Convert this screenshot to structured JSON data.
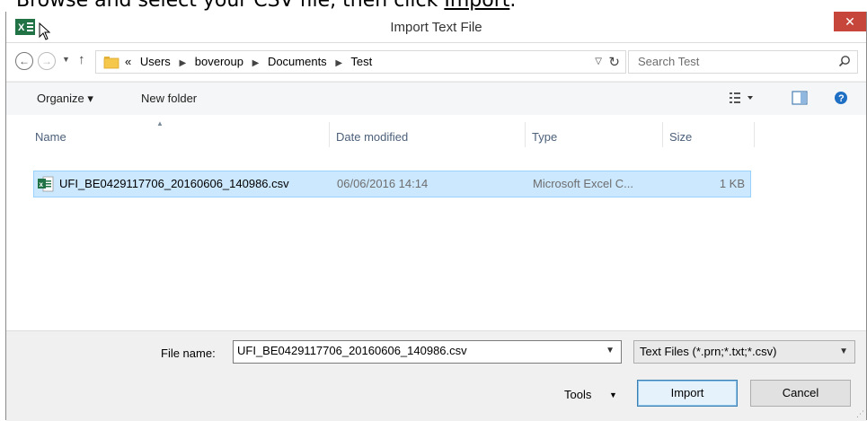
{
  "caption": {
    "prefix": "Browse and select your CSV file, then click ",
    "link": "Import",
    "suffix": "."
  },
  "window": {
    "title": "Import Text File",
    "close_glyph": "✕"
  },
  "nav": {
    "back_glyph": "←",
    "forward_glyph": "→",
    "up_glyph": "↑",
    "breadcrumb": [
      "«",
      "Users",
      "boveroup",
      "Documents",
      "Test"
    ],
    "search_placeholder": "Search Test"
  },
  "toolbar": {
    "organize_label": "Organize ▾",
    "new_folder_label": "New folder"
  },
  "columns": {
    "name": "Name",
    "date": "Date modified",
    "type": "Type",
    "size": "Size"
  },
  "files": [
    {
      "name": "UFI_BE0429117706_20160606_140986.csv",
      "date": "06/06/2016 14:14",
      "type": "Microsoft Excel C...",
      "size": "1 KB",
      "selected": true
    }
  ],
  "bottom": {
    "file_name_label": "File name:",
    "file_name_value": "UFI_BE0429117706_20160606_140986.csv",
    "filter_value": "Text Files (*.prn;*.txt;*.csv)",
    "tools_label": "Tools",
    "import_label": "Import",
    "cancel_label": "Cancel"
  },
  "colors": {
    "selection": "#cce8ff",
    "close": "#c7463b",
    "excel_green": "#217346"
  }
}
